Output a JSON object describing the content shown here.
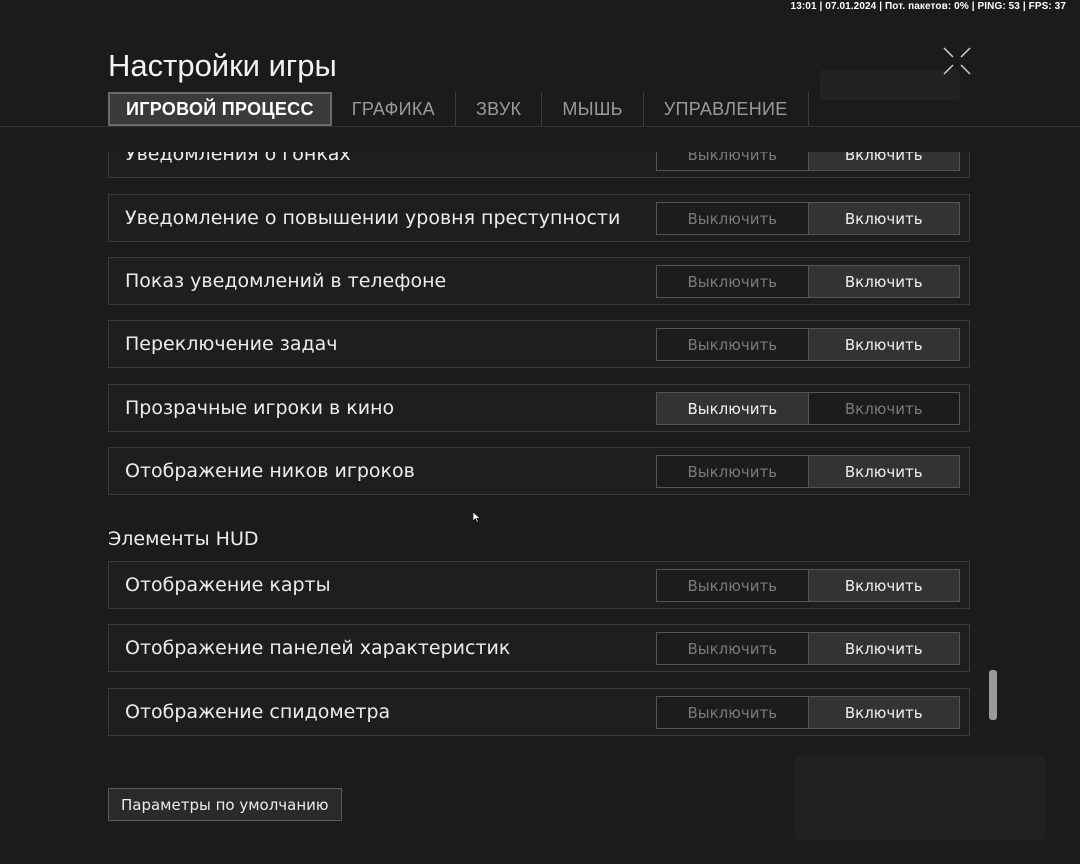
{
  "status_bar": "13:01 | 07.01.2024 | Пот. пакетов: 0% | PING: 53 | FPS: 37",
  "window": {
    "title": "Настройки игры",
    "close_icon": "close-x-icon"
  },
  "tabs": [
    {
      "label": "ИГРОВОЙ ПРОЦЕСС",
      "active": true
    },
    {
      "label": "ГРАФИКА",
      "active": false
    },
    {
      "label": "ЗВУК",
      "active": false
    },
    {
      "label": "МЫШЬ",
      "active": false
    },
    {
      "label": "УПРАВЛЕНИЕ",
      "active": false
    }
  ],
  "toggle_labels": {
    "off": "Выключить",
    "on": "Включить"
  },
  "settings": [
    {
      "label": "Уведомления о гонках",
      "value": "on"
    },
    {
      "label": "Уведомление о повышении уровня преступности",
      "value": "on"
    },
    {
      "label": "Показ уведомлений в телефоне",
      "value": "on"
    },
    {
      "label": "Переключение задач",
      "value": "on"
    },
    {
      "label": "Прозрачные игроки в кино",
      "value": "off"
    },
    {
      "label": "Отображение ников игроков",
      "value": "on"
    }
  ],
  "hud_section": {
    "title": "Элементы HUD",
    "settings": [
      {
        "label": "Отображение карты",
        "value": "on"
      },
      {
        "label": "Отображение панелей характеристик",
        "value": "on"
      },
      {
        "label": "Отображение спидометра",
        "value": "on"
      }
    ]
  },
  "defaults_button": "Параметры по умолчанию",
  "colors": {
    "background": "#1b1b1b",
    "selected_option": "#333333",
    "active_tab": "#3a3a3a"
  }
}
